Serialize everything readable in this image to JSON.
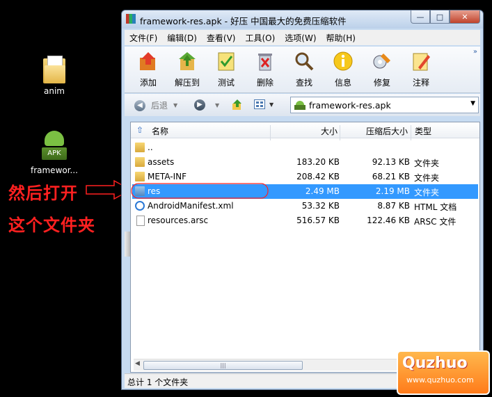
{
  "desktop": {
    "icons": [
      {
        "label": "anim"
      },
      {
        "label": "framewor..."
      }
    ],
    "apk_badge": "APK"
  },
  "annotation": {
    "line1": "然后打开",
    "line2": "这个文件夹"
  },
  "window": {
    "title": "framework-res.apk - 好压 中国最大的免费压缩软件",
    "controls": {
      "minimize": "—",
      "maximize": "□",
      "close": "✕"
    }
  },
  "menu": [
    "文件(F)",
    "编辑(D)",
    "查看(V)",
    "工具(O)",
    "选项(W)",
    "帮助(H)"
  ],
  "toolbar": {
    "tools": [
      "添加",
      "解压到",
      "测试",
      "删除",
      "查找",
      "信息",
      "修复",
      "注释"
    ],
    "more": "»"
  },
  "nav": {
    "back": "后退",
    "address": "framework-res.apk"
  },
  "columns": {
    "name": "名称",
    "size": "大小",
    "compressed": "压缩后大小",
    "type": "类型"
  },
  "files": [
    {
      "name": "..",
      "size": "",
      "compressed": "",
      "type": ""
    },
    {
      "name": "assets",
      "size": "183.20 KB",
      "compressed": "92.13 KB",
      "type": "文件夹"
    },
    {
      "name": "META-INF",
      "size": "208.42 KB",
      "compressed": "68.21 KB",
      "type": "文件夹"
    },
    {
      "name": "res",
      "size": "2.49 MB",
      "compressed": "2.19 MB",
      "type": "文件夹"
    },
    {
      "name": "AndroidManifest.xml",
      "size": "53.32 KB",
      "compressed": "8.87 KB",
      "type": "HTML 文档"
    },
    {
      "name": "resources.arsc",
      "size": "516.57 KB",
      "compressed": "122.46 KB",
      "type": "ARSC 文件"
    }
  ],
  "status": "总计 1 个文件夹",
  "watermark": {
    "logo": "Quzhuo",
    "url": "www.quzhuo.com"
  },
  "colors": {
    "selection": "#3399ff",
    "annotation": "#ff2020"
  }
}
